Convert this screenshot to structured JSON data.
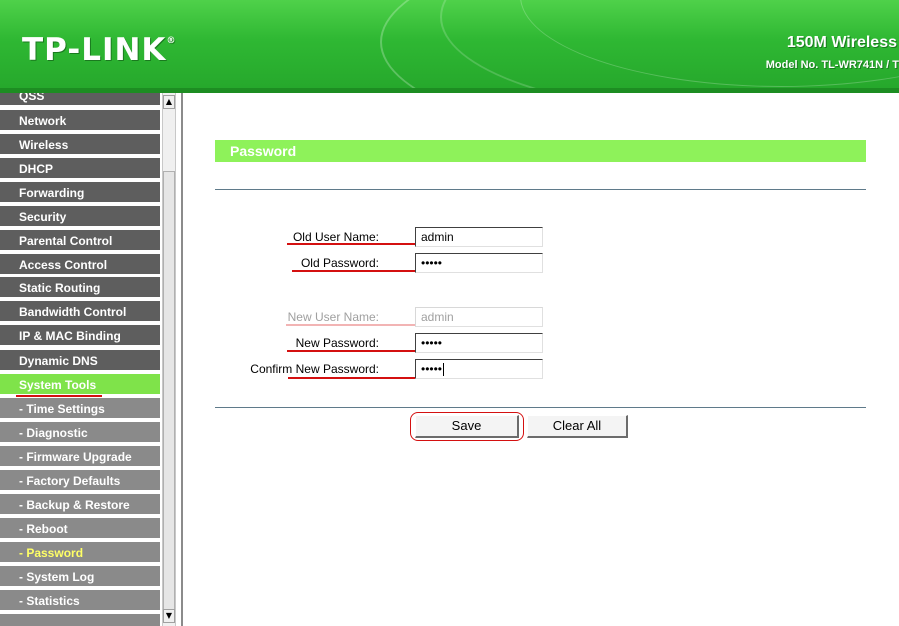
{
  "header": {
    "logo": "TP-LINK",
    "logo_mark": "®",
    "product": "150M Wireless",
    "model": "Model No. TL-WR741N / T"
  },
  "sidebar": {
    "items": [
      {
        "label": "QSS"
      },
      {
        "label": "Network"
      },
      {
        "label": "Wireless"
      },
      {
        "label": "DHCP"
      },
      {
        "label": "Forwarding"
      },
      {
        "label": "Security"
      },
      {
        "label": "Parental Control"
      },
      {
        "label": "Access Control"
      },
      {
        "label": "Static Routing"
      },
      {
        "label": "Bandwidth Control"
      },
      {
        "label": "IP & MAC Binding"
      },
      {
        "label": "Dynamic DNS"
      },
      {
        "label": "System Tools"
      },
      {
        "label": "- Time Settings"
      },
      {
        "label": "- Diagnostic"
      },
      {
        "label": "- Firmware Upgrade"
      },
      {
        "label": "- Factory Defaults"
      },
      {
        "label": "- Backup & Restore"
      },
      {
        "label": "- Reboot"
      },
      {
        "label": "- Password"
      },
      {
        "label": "- System Log"
      },
      {
        "label": "- Statistics"
      }
    ]
  },
  "scrollbar": {
    "up_arrow": "▲",
    "down_arrow": "▼"
  },
  "main": {
    "title": "Password",
    "old_user_name_label": "Old User Name:",
    "old_user_name_value": "admin",
    "old_password_label": "Old Password:",
    "old_password_value": "•••••",
    "new_user_name_label": "New User Name:",
    "new_user_name_value": "admin",
    "new_password_label": "New Password:",
    "new_password_value": "•••••",
    "confirm_password_label": "Confirm New Password:",
    "confirm_password_value": "•••••",
    "save_label": "Save",
    "clear_label": "Clear All"
  },
  "colors": {
    "brand_green": "#2fb833",
    "accent_green": "#8ef25a",
    "menu_gray": "#5e5e5e",
    "annotation_red": "#d41010"
  }
}
